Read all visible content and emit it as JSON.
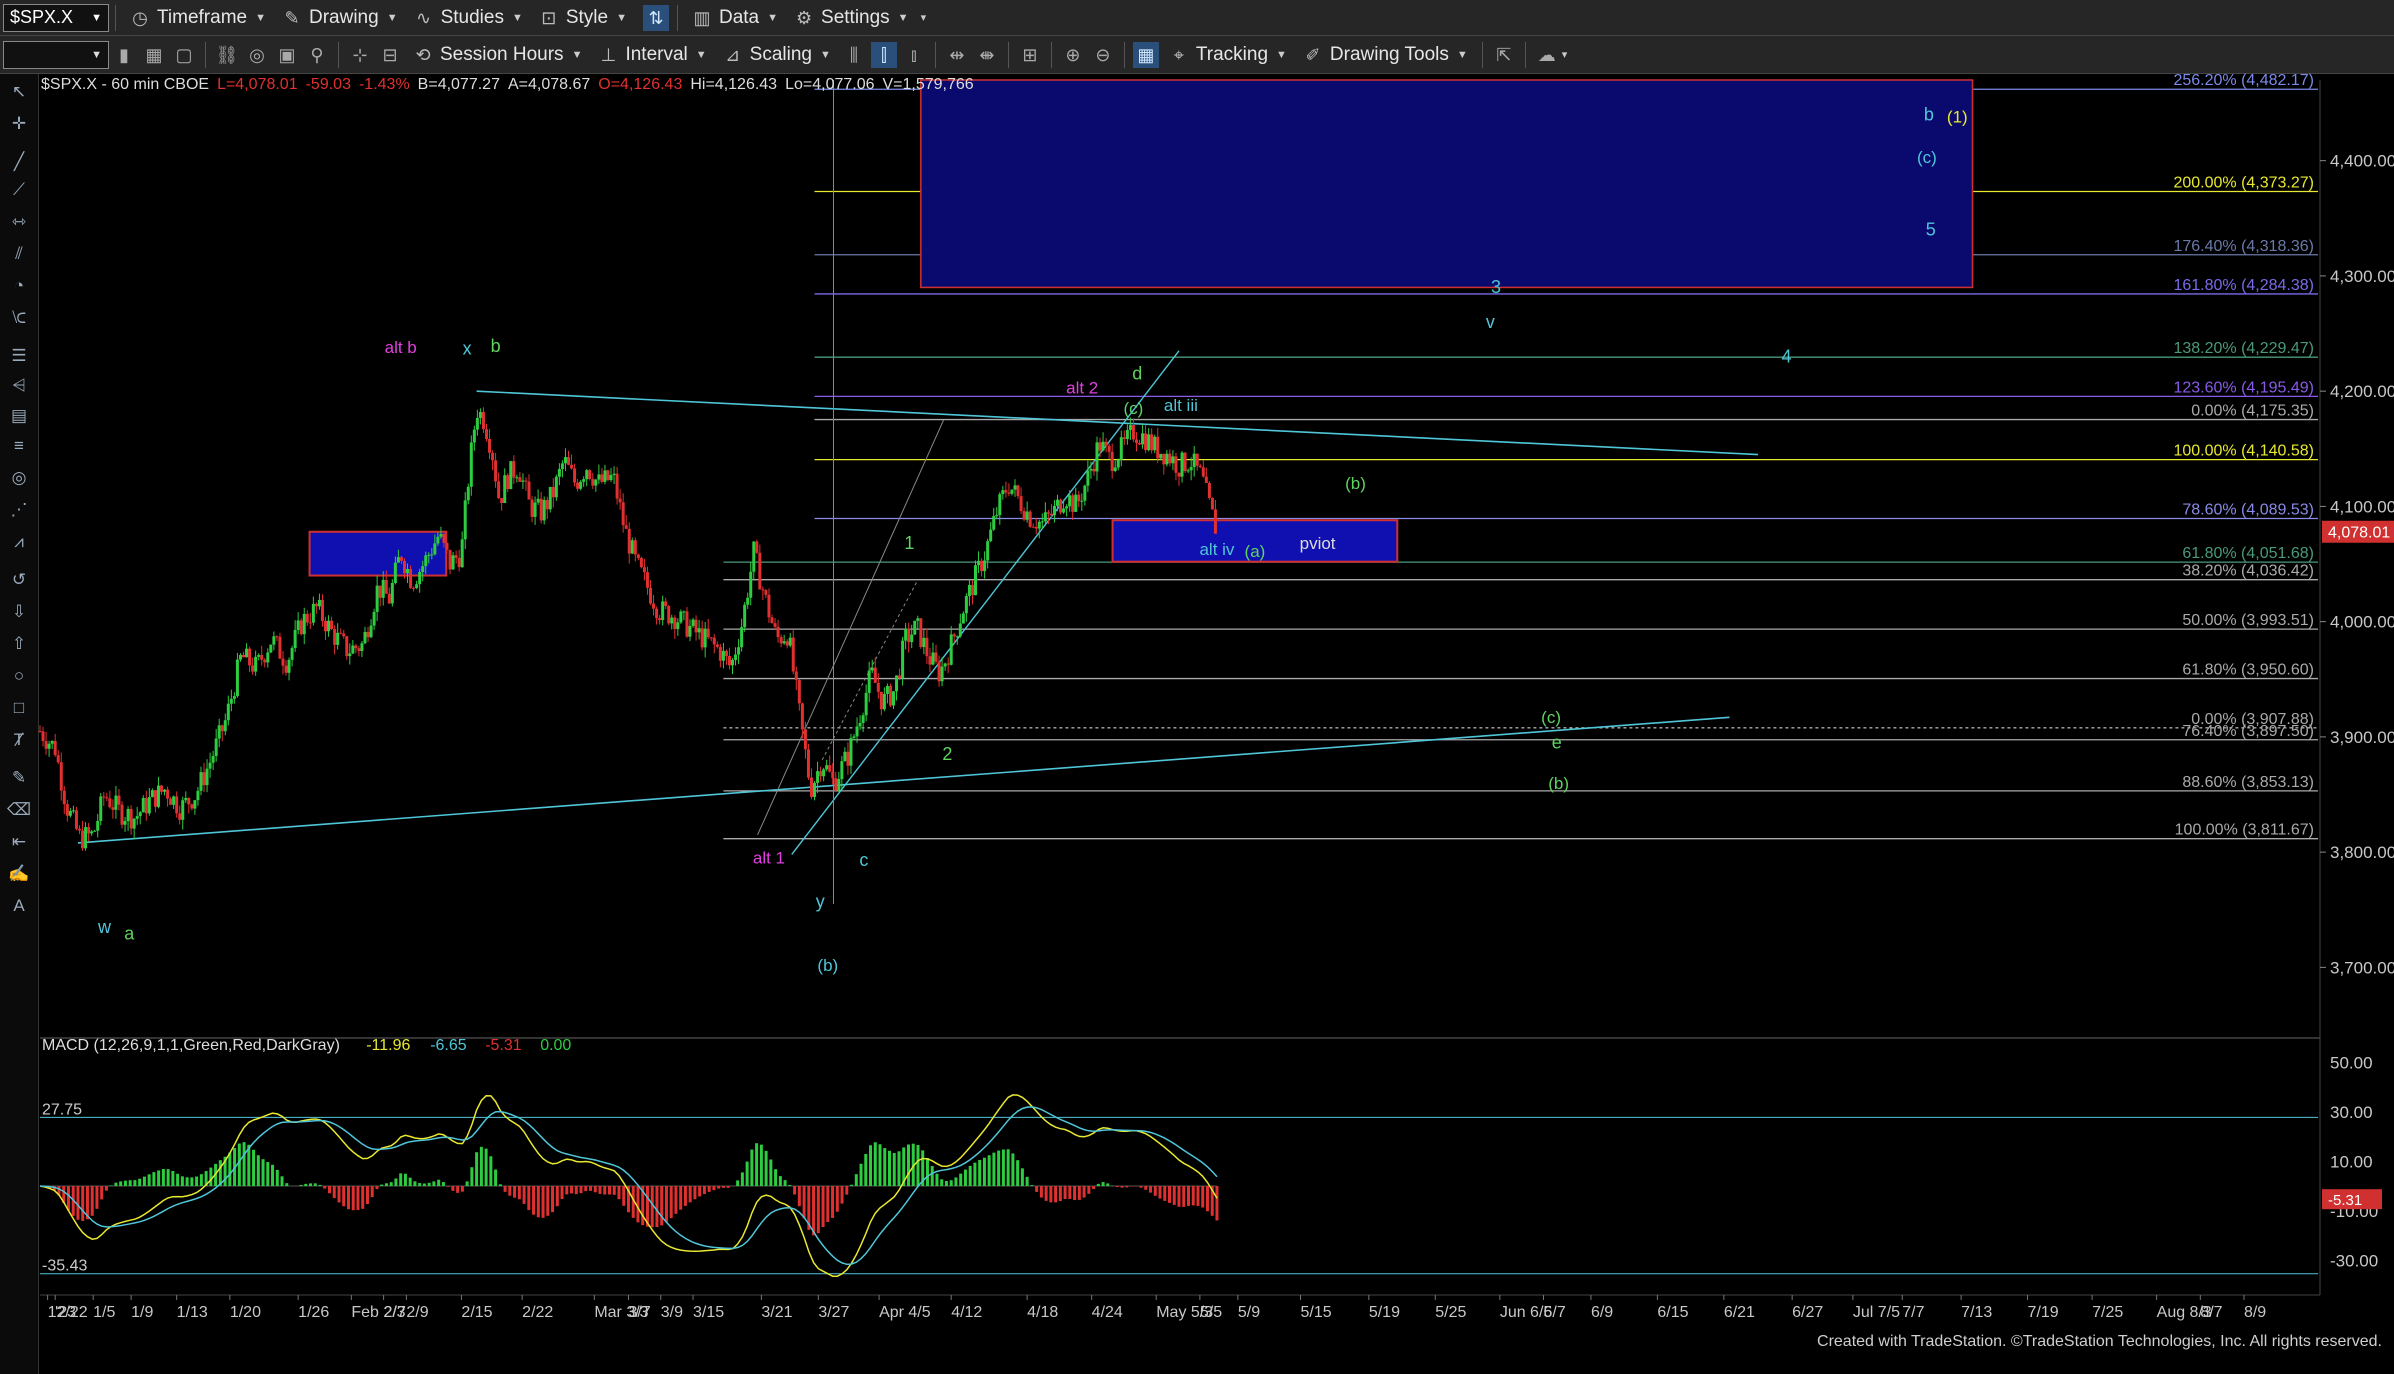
{
  "toolbar": {
    "symbol": "$SPX.X",
    "timeframe": "Timeframe",
    "drawing": "Drawing",
    "studies": "Studies",
    "style": "Style",
    "data": "Data",
    "settings": "Settings",
    "session_hours": "Session Hours",
    "interval": "Interval",
    "scaling": "Scaling",
    "tracking": "Tracking",
    "drawing_tools": "Drawing Tools"
  },
  "header": {
    "symbol_info": "$SPX.X - 60 min  CBOE",
    "last": "L=4,078.01",
    "change": "-59.03",
    "change_pct": "-1.43%",
    "bid": "B=4,077.27",
    "ask": "A=4,078.67",
    "open": "O=4,126.43",
    "high": "Hi=4,126.43",
    "low": "Lo=4,077.06",
    "volume": "V=1,579,766"
  },
  "colors": {
    "up": "#2ecc40",
    "down": "#e03030",
    "background": "#000000",
    "axis_text": "#c8c8c8",
    "cyan": "#4fc6d8",
    "magenta": "#e040e0",
    "green_label": "#5fd35f",
    "yellow": "#e8e830",
    "blue_box": "#0a0a6e",
    "red_box_border": "#d03030",
    "price_tag": "#d03030"
  },
  "chart_data": [
    {
      "type": "candlestick",
      "title": "$SPX.X - 60 min",
      "y_axis_labels": [
        "4,400.00",
        "4,300.00",
        "4,200.00",
        "4,100.00",
        "4,000.00",
        "3,900.00",
        "3,800.00",
        "3,700.00"
      ],
      "y_axis_values": [
        4400,
        4300,
        4200,
        4100,
        4000,
        3900,
        3800,
        3700
      ],
      "ylim": [
        3650,
        4470
      ],
      "x_tick_labels": [
        "12/22",
        "'23",
        "1/5",
        "1/9",
        "1/13",
        "1/20",
        "1/26",
        "Feb 2/3",
        "2/7",
        "2/9",
        "2/15",
        "2/22",
        "Mar 3/3",
        "3/7",
        "3/9",
        "3/15",
        "3/21",
        "3/27",
        "Apr 4/5",
        "4/12",
        "4/18",
        "4/24",
        "May 5/3",
        "5/5",
        "5/9",
        "5/15",
        "5/19",
        "5/25",
        "Jun 6/5",
        "6/7",
        "6/9",
        "6/15",
        "6/21",
        "6/27",
        "Jul 7/5",
        "7/7",
        "7/13",
        "7/19",
        "7/25",
        "Aug 8/3",
        "8/7",
        "8/9"
      ],
      "x_tick_positions": [
        0.4,
        0.8,
        2.8,
        4.8,
        7.2,
        10.0,
        13.6,
        16.4,
        18.1,
        19.3,
        22.2,
        25.4,
        29.2,
        31.0,
        32.7,
        34.4,
        38.0,
        41.0,
        44.2,
        48.0,
        52.0,
        55.4,
        58.8,
        61.1,
        63.1,
        66.4,
        70.0,
        73.5,
        76.9,
        79.2,
        81.7,
        85.2,
        88.7,
        92.3,
        95.5,
        98.1,
        101.2,
        104.7,
        108.1,
        111.5,
        113.8,
        116.1
      ],
      "x_range": [
        0,
        120
      ],
      "last_price_label": "4,078.01",
      "last_price": 4078.01,
      "price_path": [
        [
          0,
          3905
        ],
        [
          0.8,
          3890
        ],
        [
          1.4,
          3840
        ],
        [
          2.1,
          3812
        ],
        [
          2.8,
          3815
        ],
        [
          3.4,
          3850
        ],
        [
          4.2,
          3835
        ],
        [
          5.0,
          3830
        ],
        [
          5.8,
          3845
        ],
        [
          6.6,
          3855
        ],
        [
          7.4,
          3838
        ],
        [
          8.2,
          3850
        ],
        [
          9.0,
          3880
        ],
        [
          9.8,
          3915
        ],
        [
          10.6,
          3970
        ],
        [
          11.4,
          3960
        ],
        [
          12.2,
          3985
        ],
        [
          13.0,
          3965
        ],
        [
          13.8,
          4000
        ],
        [
          14.6,
          4012
        ],
        [
          15.4,
          3990
        ],
        [
          16.2,
          3975
        ],
        [
          17.0,
          3980
        ],
        [
          17.8,
          4030
        ],
        [
          18.4,
          4020
        ],
        [
          19.0,
          4060
        ],
        [
          19.6,
          4035
        ],
        [
          20.2,
          4050
        ],
        [
          21.0,
          4075
        ],
        [
          21.6,
          4050
        ],
        [
          22.2,
          4060
        ],
        [
          22.6,
          4130
        ],
        [
          23.0,
          4185
        ],
        [
          23.4,
          4175
        ],
        [
          23.8,
          4150
        ],
        [
          24.2,
          4105
        ],
        [
          24.6,
          4125
        ],
        [
          25.2,
          4135
        ],
        [
          25.8,
          4100
        ],
        [
          26.4,
          4095
        ],
        [
          27.0,
          4110
        ],
        [
          27.6,
          4140
        ],
        [
          28.2,
          4120
        ],
        [
          28.8,
          4135
        ],
        [
          29.4,
          4120
        ],
        [
          30.2,
          4125
        ],
        [
          30.8,
          4080
        ],
        [
          31.4,
          4050
        ],
        [
          32.0,
          4030
        ],
        [
          32.6,
          4010
        ],
        [
          33.4,
          4005
        ],
        [
          34.2,
          3995
        ],
        [
          35.0,
          3985
        ],
        [
          35.8,
          3975
        ],
        [
          36.4,
          3960
        ],
        [
          37.0,
          4000
        ],
        [
          37.6,
          4060
        ],
        [
          38.2,
          4020
        ],
        [
          38.8,
          3985
        ],
        [
          39.4,
          3990
        ],
        [
          40.0,
          3920
        ],
        [
          40.6,
          3855
        ],
        [
          41.2,
          3880
        ],
        [
          41.8,
          3860
        ],
        [
          42.6,
          3885
        ],
        [
          43.2,
          3920
        ],
        [
          43.8,
          3955
        ],
        [
          44.4,
          3930
        ],
        [
          45.0,
          3940
        ],
        [
          45.6,
          3985
        ],
        [
          46.2,
          3995
        ],
        [
          46.8,
          3970
        ],
        [
          47.4,
          3955
        ],
        [
          48.0,
          3980
        ],
        [
          48.6,
          4010
        ],
        [
          49.2,
          4035
        ],
        [
          49.8,
          4060
        ],
        [
          50.4,
          4095
        ],
        [
          51.0,
          4120
        ],
        [
          51.6,
          4105
        ],
        [
          52.2,
          4090
        ],
        [
          52.8,
          4085
        ],
        [
          53.4,
          4095
        ],
        [
          54.0,
          4110
        ],
        [
          54.6,
          4100
        ],
        [
          55.2,
          4125
        ],
        [
          55.8,
          4155
        ],
        [
          56.4,
          4140
        ],
        [
          57.0,
          4150
        ],
        [
          57.6,
          4165
        ],
        [
          58.2,
          4160
        ],
        [
          58.8,
          4150
        ],
        [
          59.4,
          4145
        ],
        [
          60.0,
          4135
        ],
        [
          60.6,
          4140
        ],
        [
          61.2,
          4125
        ],
        [
          61.6,
          4100
        ],
        [
          62.0,
          4078
        ]
      ],
      "levels": [
        {
          "label": "256.20% (4,482.17)",
          "value": 4462,
          "color": "#7a8ae8"
        },
        {
          "label": "200.00% (4,373.27)",
          "value": 4373.27,
          "color": "#e8e830"
        },
        {
          "label": "176.40% (4,318.36)",
          "value": 4318.36,
          "color": "#6a7aa8"
        },
        {
          "label": "161.80% (4,284.38)",
          "value": 4284.38,
          "color": "#7a6ae8"
        },
        {
          "label": "138.20% (4,229.47)",
          "value": 4229.47,
          "color": "#4a9a7a"
        },
        {
          "label": "123.60% (4,195.49)",
          "value": 4195.49,
          "color": "#8a5ae8"
        },
        {
          "label": "0.00% (4,175.35)",
          "value": 4175.35,
          "color": "#aaaaaa"
        },
        {
          "label": "100.00% (4,140.58)",
          "value": 4140.58,
          "color": "#e8e830"
        },
        {
          "label": "78.60% (4,089.53)",
          "value": 4089.53,
          "color": "#8a8ae8"
        },
        {
          "label": "61.80% (4,051.68)",
          "value": 4051.68,
          "color": "#4a9a7a"
        },
        {
          "label": "38.20% (4,036.42)",
          "value": 4036.42,
          "color": "#aaaaaa"
        },
        {
          "label": "50.00% (3,993.51)",
          "value": 3993.51,
          "color": "#aaaaaa"
        },
        {
          "label": "61.80% (3,950.60)",
          "value": 3950.6,
          "color": "#aaaaaa"
        },
        {
          "label": "0.00% (3,907.88)",
          "value": 3907.88,
          "color": "#aaaaaa"
        },
        {
          "label": "76.40% (3,897.50)",
          "value": 3897.5,
          "color": "#aaaaaa"
        },
        {
          "label": "88.60% (3,853.13)",
          "value": 3853.13,
          "color": "#aaaaaa"
        },
        {
          "label": "100.00% (3,811.67)",
          "value": 3811.67,
          "color": "#aaaaaa"
        }
      ],
      "wave_labels": [
        {
          "text": "alt b",
          "x": 19.0,
          "y": 4233,
          "color": "#e040e0"
        },
        {
          "text": "x",
          "x": 22.5,
          "y": 4232,
          "color": "#4fc6d8"
        },
        {
          "text": "b",
          "x": 24.0,
          "y": 4234,
          "color": "#5fd35f"
        },
        {
          "text": "w",
          "x": 3.4,
          "y": 3730,
          "color": "#4fc6d8"
        },
        {
          "text": "a",
          "x": 4.7,
          "y": 3724,
          "color": "#5fd35f"
        },
        {
          "text": "alt 1",
          "x": 38.4,
          "y": 3790,
          "color": "#e040e0"
        },
        {
          "text": "c",
          "x": 43.4,
          "y": 3788,
          "color": "#4fc6d8"
        },
        {
          "text": "y",
          "x": 41.1,
          "y": 3752,
          "color": "#4fc6d8"
        },
        {
          "text": "(b)",
          "x": 41.5,
          "y": 3697,
          "color": "#4fc6d8"
        },
        {
          "text": "1",
          "x": 45.8,
          "y": 4063,
          "color": "#5fd35f"
        },
        {
          "text": "2",
          "x": 47.8,
          "y": 3880,
          "color": "#5fd35f"
        },
        {
          "text": "alt 2",
          "x": 54.9,
          "y": 4198,
          "color": "#e040e0"
        },
        {
          "text": "d",
          "x": 57.8,
          "y": 4210,
          "color": "#5fd35f"
        },
        {
          "text": "(c)",
          "x": 57.6,
          "y": 4180,
          "color": "#5fd35f"
        },
        {
          "text": "alt iii",
          "x": 60.1,
          "y": 4183,
          "color": "#4fc6d8"
        },
        {
          "text": "alt iv",
          "x": 62.0,
          "y": 4058,
          "color": "#4fc6d8"
        },
        {
          "text": "(a)",
          "x": 64.0,
          "y": 4056,
          "color": "#5fd35f"
        },
        {
          "text": "pviot",
          "x": 67.3,
          "y": 4063,
          "color": "#dddddd"
        },
        {
          "text": "(b)",
          "x": 69.3,
          "y": 4115,
          "color": "#5fd35f"
        },
        {
          "text": "3",
          "x": 76.7,
          "y": 4285,
          "color": "#4fc6d8"
        },
        {
          "text": "v",
          "x": 76.4,
          "y": 4255,
          "color": "#4fc6d8"
        },
        {
          "text": "4",
          "x": 92.0,
          "y": 4225,
          "color": "#4fc6d8"
        },
        {
          "text": "(c)",
          "x": 79.6,
          "y": 3912,
          "color": "#5fd35f"
        },
        {
          "text": "e",
          "x": 79.9,
          "y": 3890,
          "color": "#5fd35f"
        },
        {
          "text": "(b)",
          "x": 80.0,
          "y": 3855,
          "color": "#5fd35f"
        },
        {
          "text": "b",
          "x": 99.5,
          "y": 4435,
          "color": "#4fc6d8"
        },
        {
          "text": "(1)",
          "x": 101.0,
          "y": 4433,
          "color": "#e8e830"
        },
        {
          "text": "(c)",
          "x": 99.4,
          "y": 4398,
          "color": "#4fc6d8"
        },
        {
          "text": "5",
          "x": 99.6,
          "y": 4335,
          "color": "#4fc6d8"
        }
      ]
    },
    {
      "type": "macd",
      "label": "MACD (12,26,9,1,1,Green,Red,DarkGray)",
      "values_text": [
        "-11.96",
        "-6.65",
        "-5.31",
        "0.00"
      ],
      "values_colors": [
        "#e8e830",
        "#4fc6d8",
        "#e03030",
        "#2ecc40"
      ],
      "y_axis_labels": [
        "50.00",
        "30.00",
        "10.00",
        "-10.00",
        "-30.00"
      ],
      "y_axis_values": [
        50,
        30,
        10,
        -10,
        -30
      ],
      "ylim": [
        -40,
        55
      ],
      "ref_labels": [
        {
          "text": "27.75",
          "value": 27.75
        },
        {
          "text": "-35.43",
          "value": -35.43
        }
      ],
      "last_label": "-5.31",
      "last_value": -5.31
    }
  ],
  "footer": "Created with TradeStation. ©TradeStation Technologies, Inc. All rights reserved."
}
